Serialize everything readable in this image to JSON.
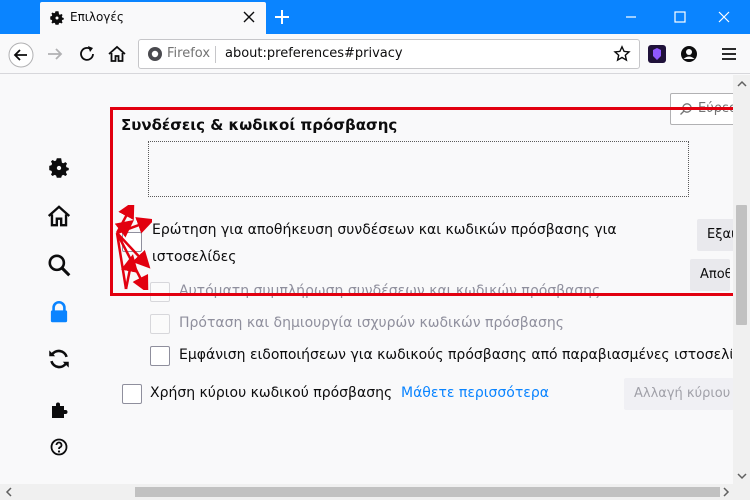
{
  "browser": {
    "tab_title": "Επιλογές",
    "url_identity": "Firefox",
    "url": "about:preferences#privacy"
  },
  "search": {
    "placeholder": "Εύρεση"
  },
  "section": {
    "title": "Συνδέσεις & κωδικοί πρόσβασης",
    "ask_save_line1": "Ερώτηση για αποθήκευση συνδέσεων και κωδικών πρόσβασης για",
    "ask_save_line2": "ιστοσελίδες",
    "autofill": "Αυτόματη συμπλήρωση συνδέσεων και κωδικών πρόσβασης",
    "suggest": "Πρόταση και δημιουργία ισχυρών κωδικών πρόσβασης",
    "breach_alerts": "Εμφάνιση ειδοποιήσεων για κωδικούς πρόσβασης από παραβιασμένες ιστοσελίδες",
    "exceptions_button": "Εξαιρέσεις...",
    "saved_logins_button": "Αποθηκευμένες συνδέσεις..."
  },
  "master_password": {
    "label": "Χρήση κύριου κωδικού πρόσβασης",
    "learn_more": "Μάθετε περισσότερα",
    "change_button": "Αλλαγή κύριου κωδικού..."
  },
  "colors": {
    "accent": "#0a84ff",
    "highlight": "#e2000f"
  }
}
